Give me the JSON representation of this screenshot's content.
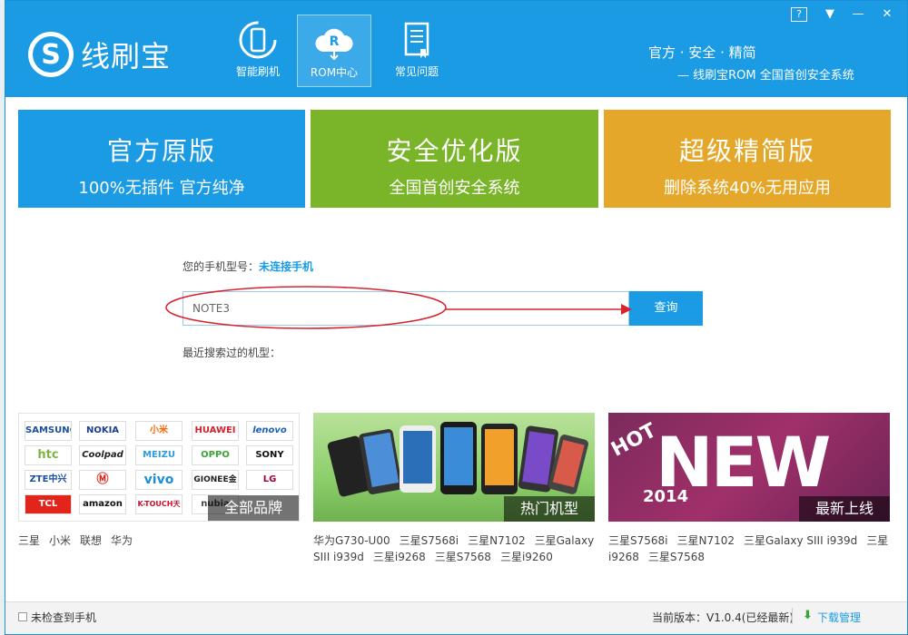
{
  "app": {
    "name": "线刷宝"
  },
  "nav": [
    {
      "label": "智能刷机",
      "icon": "phone-refresh-icon"
    },
    {
      "label": "ROM中心",
      "icon": "rom-cloud-icon"
    },
    {
      "label": "常见问题",
      "icon": "faq-book-icon"
    }
  ],
  "window_controls": {
    "help": "?",
    "menu": "▼",
    "minimize": "—",
    "close": "✕"
  },
  "header_right": {
    "tagline1": "官方 · 安全 · 精简",
    "tagline2": "— 线刷宝ROM 全国首创安全系统"
  },
  "banners": [
    {
      "title": "官方原版",
      "subtitle": "100%无插件 官方纯净",
      "color": "#1a9be4"
    },
    {
      "title": "安全优化版",
      "subtitle": "全国首创安全系统",
      "color": "#7ab529"
    },
    {
      "title": "超级精简版",
      "subtitle": "删除系统40%无用应用",
      "color": "#e5a72a"
    }
  ],
  "search": {
    "phone_label": "您的手机型号：",
    "phone_status": "未连接手机",
    "input_value": "NOTE3",
    "button_label": "查询",
    "recent_label": "最近搜索过的机型："
  },
  "brands": [
    "SAMSUNG",
    "NOKIA",
    "小米",
    "HUAWEI",
    "lenovo",
    "htc",
    "Coolpad",
    "MEIZU",
    "OPPO",
    "SONY",
    "ZTE中兴",
    "Motorola",
    "vivo",
    "GIONEE金立",
    "LG",
    "TCL",
    "amazon",
    "K-TOUCH天语",
    "nubia",
    "..."
  ],
  "tiles": [
    {
      "caption": "全部品牌",
      "links": [
        "三星",
        "小米",
        "联想",
        "华为"
      ]
    },
    {
      "caption": "热门机型",
      "links": [
        "华为G730-U00",
        "三星S7568i",
        "三星N7102",
        "三星Galaxy SIII i939d",
        "三星i9268",
        "三星S7568",
        "三星i9260"
      ]
    },
    {
      "caption": "最新上线",
      "hot": "HOT",
      "new": "NEW",
      "year": "2014",
      "links": [
        "三星S7568i",
        "三星N7102",
        "三星Galaxy SIII i939d",
        "三星i9268",
        "三星S7568"
      ]
    }
  ],
  "status": {
    "left": "未检查到手机",
    "version": "当前版本：V1.0.4(已经最新)",
    "download": "下载管理"
  }
}
